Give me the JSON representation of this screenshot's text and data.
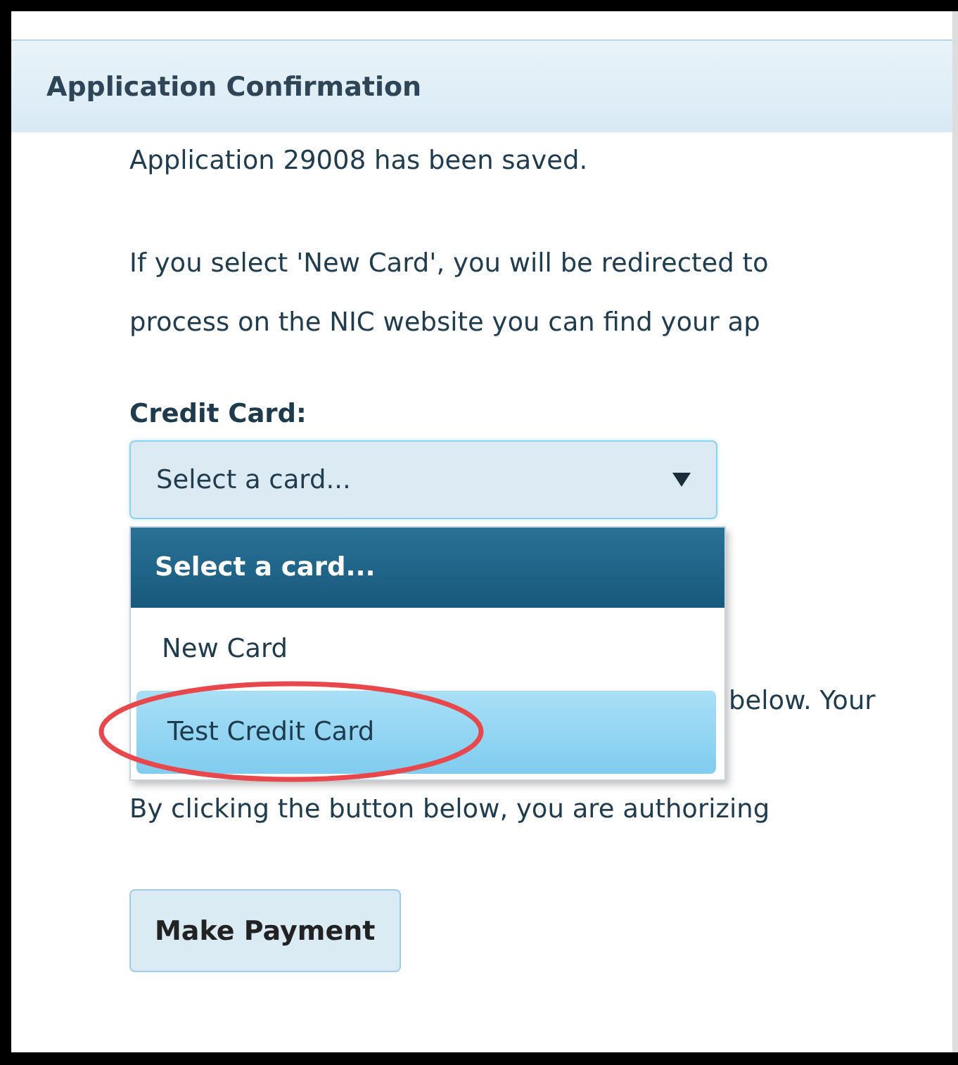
{
  "panel": {
    "title": "Application Confirmation"
  },
  "message": "Application 29008 has been saved.",
  "notice_lines": [
    "If you select 'New Card', you will be redirected to",
    "process on the NIC website you can find your ap"
  ],
  "credit_card": {
    "label": "Credit Card:",
    "value": "Select a card...",
    "expanded": true,
    "options": [
      {
        "label": "Select a card...",
        "selected": true,
        "hovered": false
      },
      {
        "label": "New Card",
        "selected": false,
        "hovered": false
      },
      {
        "label": "Test Credit Card",
        "selected": false,
        "hovered": true
      }
    ]
  },
  "covered_line": "below. Your",
  "authorize_line": "By clicking the button below, you are authorizing",
  "button": "Make Payment"
}
